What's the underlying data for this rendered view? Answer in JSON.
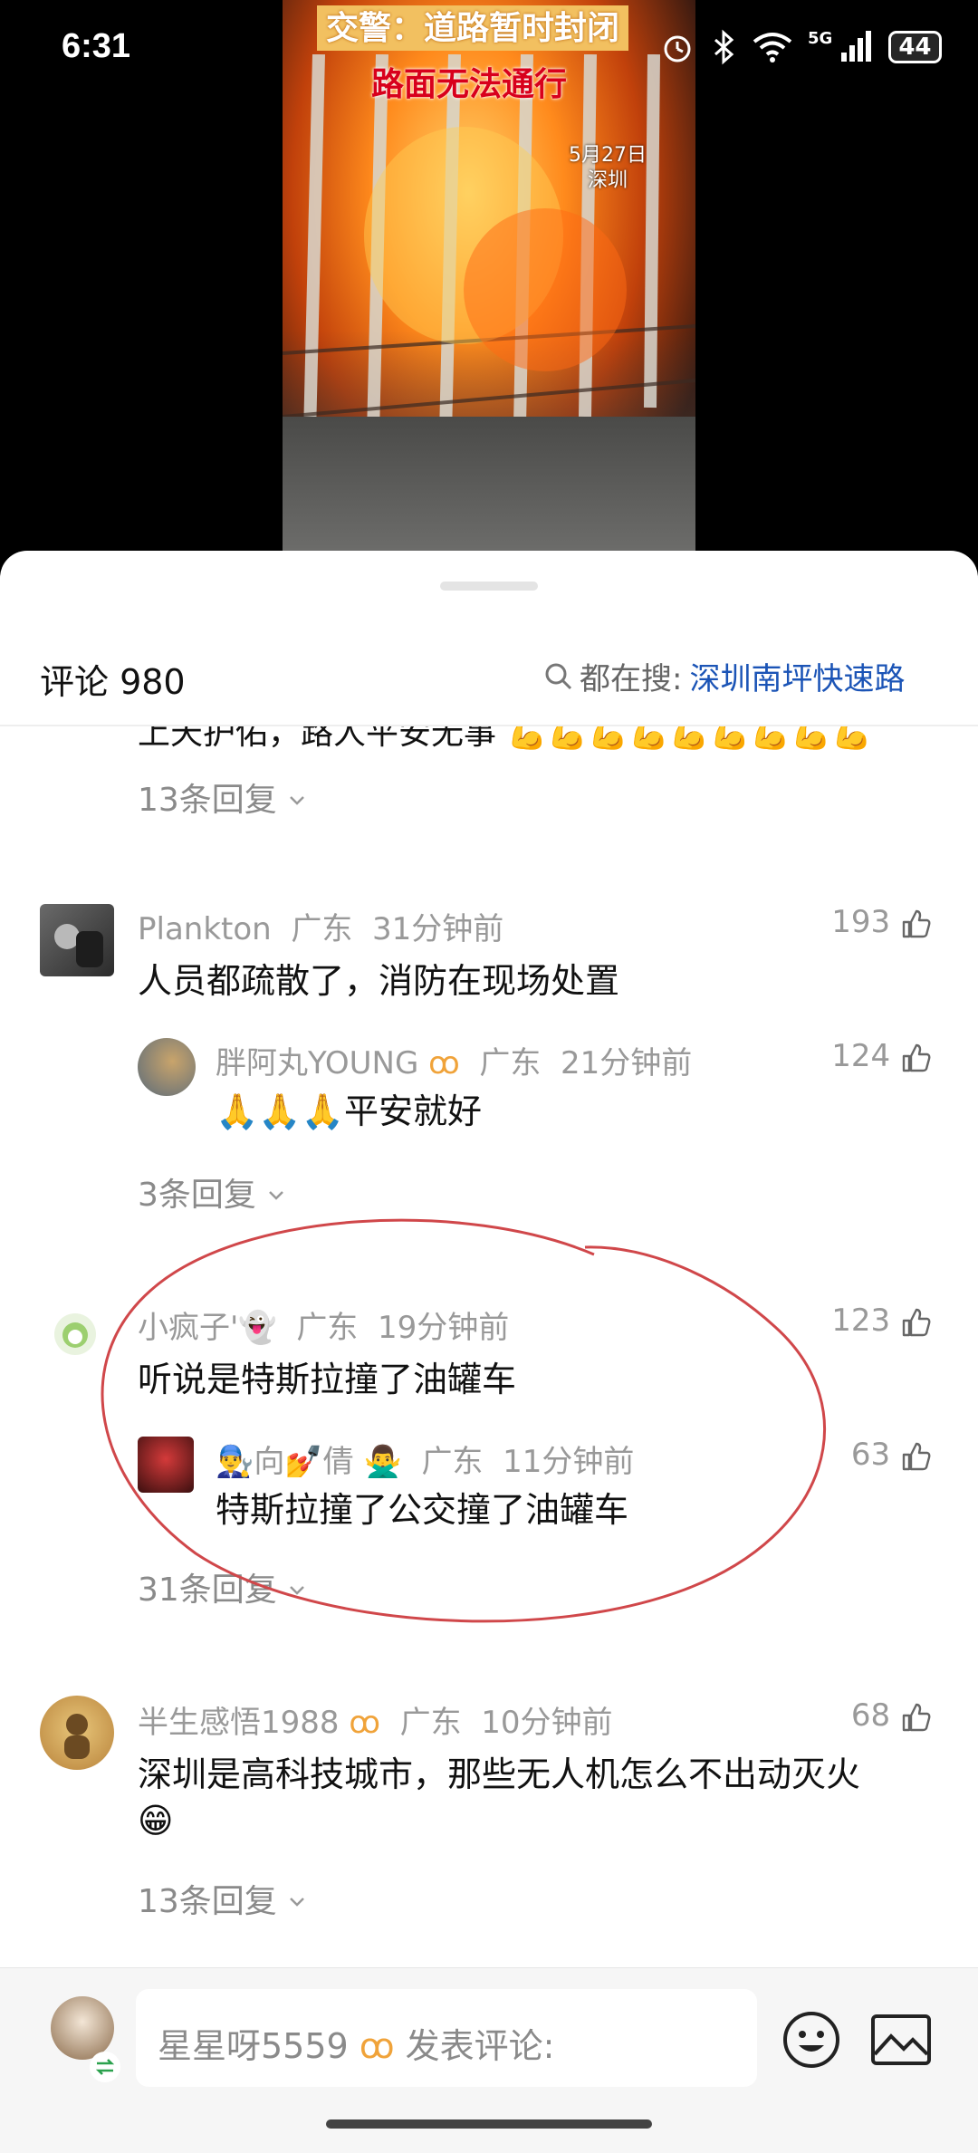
{
  "status_bar": {
    "time": "6:31",
    "battery": "44",
    "network": "5G"
  },
  "video": {
    "caption_top": "交警：道路暂时封闭",
    "caption_bottom": "路面无法通行",
    "date": "5月27日",
    "place": "深圳"
  },
  "sheet": {
    "comments_title": "评论 980",
    "search_prefix": "都在搜:",
    "search_link": "深圳南坪快速路"
  },
  "partial_comment": {
    "text": "上天护佑，路人平安无事",
    "replies": "13条回复"
  },
  "comments": [
    {
      "user": "Plankton",
      "region": "广东",
      "time": "31分钟前",
      "likes": "193",
      "text": "人员都疏散了，消防在现场处置",
      "reply": {
        "user": "胖阿丸YOUNG",
        "region": "广东",
        "time": "21分钟前",
        "likes": "124",
        "text": "🙏🙏🙏平安就好"
      },
      "replies": "3条回复"
    },
    {
      "user": "小疯子'👻",
      "region": "广东",
      "time": "19分钟前",
      "likes": "123",
      "text": "听说是特斯拉撞了油罐车",
      "reply": {
        "user": "👨‍🔧向💅倩 🙅‍♂️",
        "region": "广东",
        "time": "11分钟前",
        "likes": "63",
        "text": "特斯拉撞了公交撞了油罐车"
      },
      "replies": "31条回复"
    },
    {
      "user": "半生感悟1988",
      "region": "广东",
      "time": "10分钟前",
      "likes": "68",
      "text": "深圳是高科技城市，那些无人机怎么不出动灭火",
      "text2": "😁",
      "replies": "13条回复"
    }
  ],
  "composer": {
    "placeholder_user": "星星呀5559",
    "placeholder_action": "发表评论:"
  },
  "colors": {
    "link": "#1b54b6",
    "annotation": "#d0474a",
    "vip_badge": "#f0a33a"
  }
}
